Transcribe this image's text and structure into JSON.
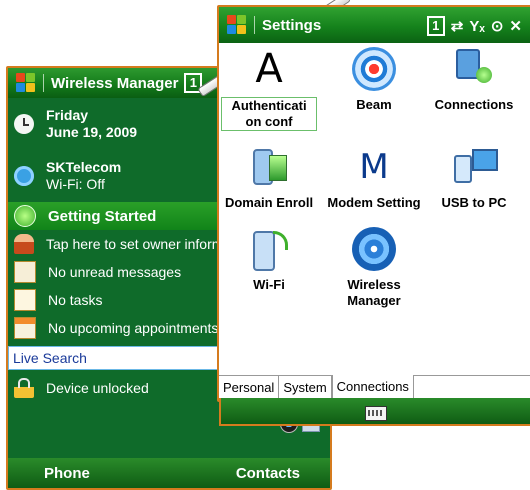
{
  "today_window": {
    "title": "Wireless Manager",
    "title_signal": "1",
    "date_weekday": "Friday",
    "date_full": "June 19, 2009",
    "carrier": "SKTelecom",
    "wifi_status": "Wi-Fi: Off",
    "getting_started": "Getting Started",
    "owner_info": "Tap here to set owner information",
    "messages": "No unread messages",
    "tasks": "No tasks",
    "appointments": "No upcoming appointments",
    "search": "Live Search",
    "lock_status": "Device unlocked",
    "softkey_left": "Phone",
    "softkey_right": "Contacts"
  },
  "settings_window": {
    "title": "Settings",
    "status": {
      "signal": "1",
      "sync": "⇄",
      "antenna": "Yₓ",
      "volume": "⊙",
      "close": "✕"
    },
    "items": [
      {
        "label": "Authenticati on conf",
        "icon": "letter-a-icon"
      },
      {
        "label": "Beam",
        "icon": "beam-icon"
      },
      {
        "label": "Connections",
        "icon": "connections-icon"
      },
      {
        "label": "Domain Enroll",
        "icon": "domain-enroll-icon"
      },
      {
        "label": "Modem Setting",
        "icon": "letter-m-icon"
      },
      {
        "label": "USB to PC",
        "icon": "usb-to-pc-icon"
      },
      {
        "label": "Wi-Fi",
        "icon": "wifi-icon"
      },
      {
        "label": "Wireless Manager",
        "icon": "wireless-manager-icon"
      }
    ],
    "tile_glyphs": {
      "a": "A",
      "m": "M"
    },
    "tabs": [
      "Personal",
      "System",
      "Connections"
    ],
    "active_tab": "Connections"
  }
}
